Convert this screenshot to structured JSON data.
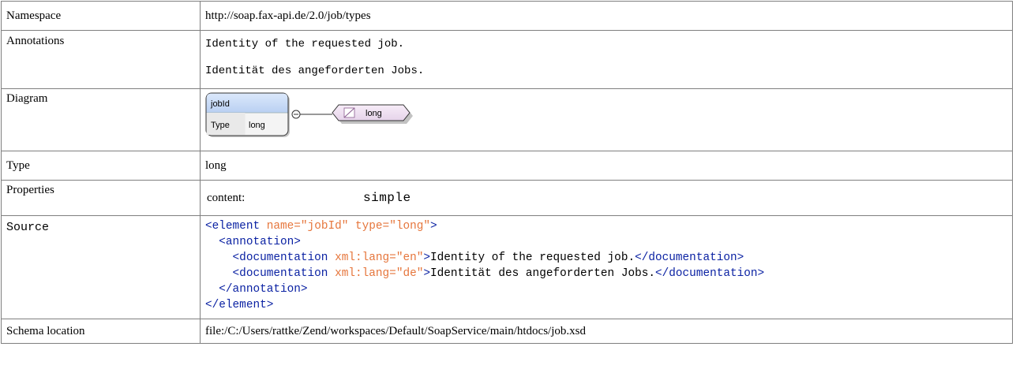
{
  "rows": {
    "namespace": {
      "label": "Namespace",
      "value": "http://soap.fax-api.de/2.0/job/types"
    },
    "annotations": {
      "label": "Annotations",
      "lines": [
        "Identity of the requested job.",
        "Identität des angeforderten Jobs."
      ]
    },
    "diagram": {
      "label": "Diagram",
      "element_name": "jobId",
      "type_label": "Type",
      "type_value": "long",
      "simple_type_name": "long"
    },
    "type": {
      "label": "Type",
      "value": "long"
    },
    "properties": {
      "label": "Properties",
      "content_label": "content:",
      "content_value": "simple"
    },
    "source": {
      "label": "Source",
      "element_open": "<element",
      "name_attr": "name=",
      "name_val": "\"jobId\"",
      "type_attr": "type=",
      "type_val": "\"long\"",
      "gt": ">",
      "annotation_open": "<annotation>",
      "doc_open": "<documentation",
      "lang_attr": "xml:lang=",
      "lang_en": "\"en\"",
      "lang_de": "\"de\"",
      "doc_en_text": "Identity of the requested job.",
      "doc_de_text": "Identität des angeforderten Jobs.",
      "doc_close": "</documentation>",
      "annotation_close": "</annotation>",
      "element_close": "</element>"
    },
    "schema_location": {
      "label": "Schema location",
      "value": "file:/C:/Users/rattke/Zend/workspaces/Default/SoapService/main/htdocs/job.xsd"
    }
  },
  "colors": {
    "tag": "#0b22a3",
    "attribute": "#e6763c",
    "border": "#7f7f7f",
    "element_box_top": "#c6d9f6",
    "simpletype_fill": "#efe1f1"
  },
  "icons": {
    "sequence_connector": "minus-circle-icon",
    "simple_type": "simple-type-icon"
  }
}
